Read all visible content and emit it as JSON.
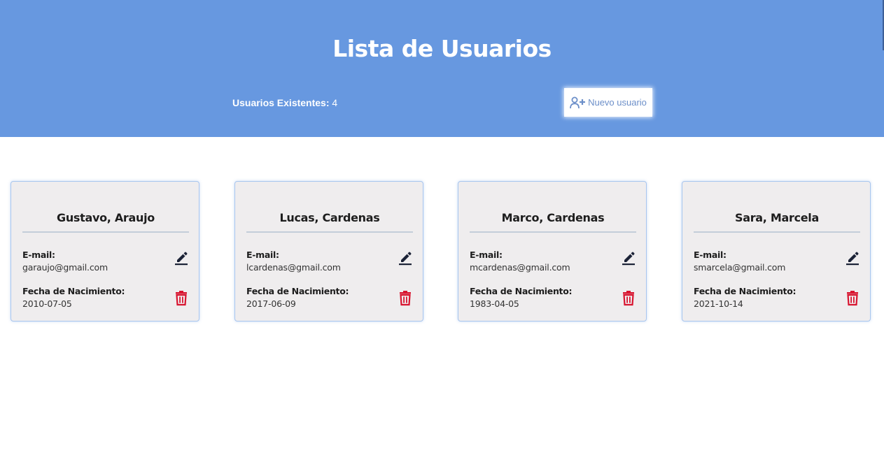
{
  "header": {
    "title": "Lista de Usuarios",
    "count_label": "Usuarios Existentes:",
    "count_value": "4",
    "new_user_label": "Nuevo usuario",
    "new_user_icon": "user-plus-icon"
  },
  "fields": {
    "email_label": "E-mail:",
    "birth_label": "Fecha de Nacimiento:"
  },
  "users": [
    {
      "name": "Gustavo, Araujo",
      "email": "garaujo@gmail.com",
      "birth": "2010-07-05"
    },
    {
      "name": "Lucas, Cardenas",
      "email": "lcardenas@gmail.com",
      "birth": "2017-06-09"
    },
    {
      "name": "Marco, Cardenas",
      "email": "mcardenas@gmail.com",
      "birth": "1983-04-05"
    },
    {
      "name": "Sara, Marcela",
      "email": "smarcela@gmail.com",
      "birth": "2021-10-14"
    }
  ],
  "icons": {
    "edit": "pencil-icon",
    "delete": "trash-icon"
  },
  "colors": {
    "header_bg": "#6798e0",
    "card_bg": "#efedee",
    "card_border": "#a8c6ef",
    "edit_icon": "#1b2236",
    "delete_icon": "#d81530",
    "button_text": "#6c8fc9"
  }
}
